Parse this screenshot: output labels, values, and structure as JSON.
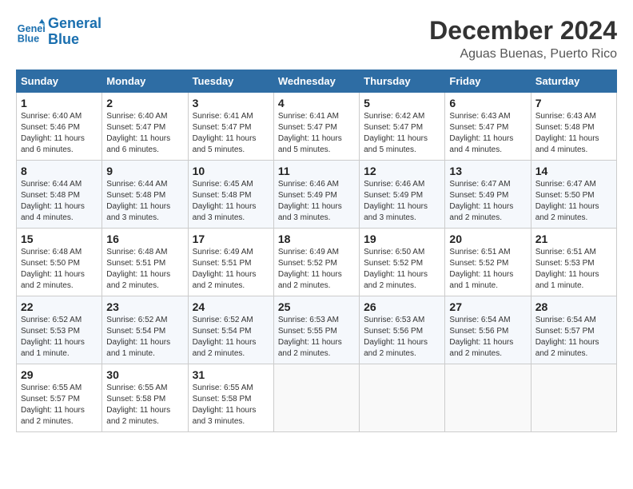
{
  "logo": {
    "line1": "General",
    "line2": "Blue"
  },
  "title": "December 2024",
  "location": "Aguas Buenas, Puerto Rico",
  "days_of_week": [
    "Sunday",
    "Monday",
    "Tuesday",
    "Wednesday",
    "Thursday",
    "Friday",
    "Saturday"
  ],
  "weeks": [
    [
      {
        "day": "1",
        "sunrise": "6:40 AM",
        "sunset": "5:46 PM",
        "daylight": "11 hours and 6 minutes."
      },
      {
        "day": "2",
        "sunrise": "6:40 AM",
        "sunset": "5:47 PM",
        "daylight": "11 hours and 6 minutes."
      },
      {
        "day": "3",
        "sunrise": "6:41 AM",
        "sunset": "5:47 PM",
        "daylight": "11 hours and 5 minutes."
      },
      {
        "day": "4",
        "sunrise": "6:41 AM",
        "sunset": "5:47 PM",
        "daylight": "11 hours and 5 minutes."
      },
      {
        "day": "5",
        "sunrise": "6:42 AM",
        "sunset": "5:47 PM",
        "daylight": "11 hours and 5 minutes."
      },
      {
        "day": "6",
        "sunrise": "6:43 AM",
        "sunset": "5:47 PM",
        "daylight": "11 hours and 4 minutes."
      },
      {
        "day": "7",
        "sunrise": "6:43 AM",
        "sunset": "5:48 PM",
        "daylight": "11 hours and 4 minutes."
      }
    ],
    [
      {
        "day": "8",
        "sunrise": "6:44 AM",
        "sunset": "5:48 PM",
        "daylight": "11 hours and 4 minutes."
      },
      {
        "day": "9",
        "sunrise": "6:44 AM",
        "sunset": "5:48 PM",
        "daylight": "11 hours and 3 minutes."
      },
      {
        "day": "10",
        "sunrise": "6:45 AM",
        "sunset": "5:48 PM",
        "daylight": "11 hours and 3 minutes."
      },
      {
        "day": "11",
        "sunrise": "6:46 AM",
        "sunset": "5:49 PM",
        "daylight": "11 hours and 3 minutes."
      },
      {
        "day": "12",
        "sunrise": "6:46 AM",
        "sunset": "5:49 PM",
        "daylight": "11 hours and 3 minutes."
      },
      {
        "day": "13",
        "sunrise": "6:47 AM",
        "sunset": "5:49 PM",
        "daylight": "11 hours and 2 minutes."
      },
      {
        "day": "14",
        "sunrise": "6:47 AM",
        "sunset": "5:50 PM",
        "daylight": "11 hours and 2 minutes."
      }
    ],
    [
      {
        "day": "15",
        "sunrise": "6:48 AM",
        "sunset": "5:50 PM",
        "daylight": "11 hours and 2 minutes."
      },
      {
        "day": "16",
        "sunrise": "6:48 AM",
        "sunset": "5:51 PM",
        "daylight": "11 hours and 2 minutes."
      },
      {
        "day": "17",
        "sunrise": "6:49 AM",
        "sunset": "5:51 PM",
        "daylight": "11 hours and 2 minutes."
      },
      {
        "day": "18",
        "sunrise": "6:49 AM",
        "sunset": "5:52 PM",
        "daylight": "11 hours and 2 minutes."
      },
      {
        "day": "19",
        "sunrise": "6:50 AM",
        "sunset": "5:52 PM",
        "daylight": "11 hours and 2 minutes."
      },
      {
        "day": "20",
        "sunrise": "6:51 AM",
        "sunset": "5:52 PM",
        "daylight": "11 hours and 1 minute."
      },
      {
        "day": "21",
        "sunrise": "6:51 AM",
        "sunset": "5:53 PM",
        "daylight": "11 hours and 1 minute."
      }
    ],
    [
      {
        "day": "22",
        "sunrise": "6:52 AM",
        "sunset": "5:53 PM",
        "daylight": "11 hours and 1 minute."
      },
      {
        "day": "23",
        "sunrise": "6:52 AM",
        "sunset": "5:54 PM",
        "daylight": "11 hours and 1 minute."
      },
      {
        "day": "24",
        "sunrise": "6:52 AM",
        "sunset": "5:54 PM",
        "daylight": "11 hours and 2 minutes."
      },
      {
        "day": "25",
        "sunrise": "6:53 AM",
        "sunset": "5:55 PM",
        "daylight": "11 hours and 2 minutes."
      },
      {
        "day": "26",
        "sunrise": "6:53 AM",
        "sunset": "5:56 PM",
        "daylight": "11 hours and 2 minutes."
      },
      {
        "day": "27",
        "sunrise": "6:54 AM",
        "sunset": "5:56 PM",
        "daylight": "11 hours and 2 minutes."
      },
      {
        "day": "28",
        "sunrise": "6:54 AM",
        "sunset": "5:57 PM",
        "daylight": "11 hours and 2 minutes."
      }
    ],
    [
      {
        "day": "29",
        "sunrise": "6:55 AM",
        "sunset": "5:57 PM",
        "daylight": "11 hours and 2 minutes."
      },
      {
        "day": "30",
        "sunrise": "6:55 AM",
        "sunset": "5:58 PM",
        "daylight": "11 hours and 2 minutes."
      },
      {
        "day": "31",
        "sunrise": "6:55 AM",
        "sunset": "5:58 PM",
        "daylight": "11 hours and 3 minutes."
      },
      null,
      null,
      null,
      null
    ]
  ]
}
